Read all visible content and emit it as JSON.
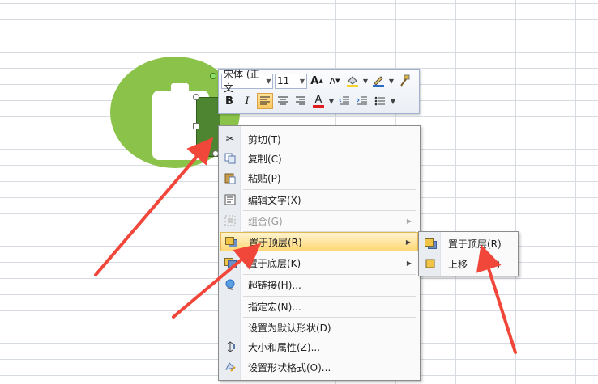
{
  "toolbar": {
    "font_name": "宋体 (正文",
    "font_size": "11",
    "grow_font_glyph": "A",
    "shrink_font_glyph": "A",
    "bold_glyph": "B",
    "italic_glyph": "I",
    "font_color_glyph": "A",
    "fill_color": "#f5d32b",
    "line_color": "#2b6cc4",
    "font_color": "#e02020",
    "icons": [
      "grow-font-icon",
      "shrink-font-icon",
      "fill-color-icon",
      "line-color-icon",
      "format-painter-icon",
      "bold-icon",
      "italic-icon",
      "align-left-icon",
      "align-center-icon",
      "align-right-icon",
      "font-color-icon",
      "decrease-indent-icon",
      "increase-indent-icon",
      "bullets-icon"
    ]
  },
  "context_menu": {
    "items": [
      {
        "label": "剪切(T)",
        "icon": "scissors-icon"
      },
      {
        "label": "复制(C)",
        "icon": "copy-icon"
      },
      {
        "label": "粘贴(P)",
        "icon": "paste-icon"
      },
      {
        "label": "编辑文字(X)",
        "icon": "edit-text-icon"
      },
      {
        "label": "组合(G)",
        "icon": "group-icon",
        "disabled": true
      },
      {
        "label": "置于顶层(R)",
        "icon": "bring-to-front-icon",
        "highlighted": true
      },
      {
        "label": "置于底层(K)",
        "icon": "send-to-back-icon"
      },
      {
        "label": "超链接(H)...",
        "icon": "hyperlink-icon"
      },
      {
        "label": "指定宏(N)...",
        "icon": ""
      },
      {
        "label": "设置为默认形状(D)",
        "icon": ""
      },
      {
        "label": "大小和属性(Z)...",
        "icon": "size-icon"
      },
      {
        "label": "设置形状格式(O)...",
        "icon": "format-shape-icon"
      }
    ]
  },
  "submenu": {
    "items": [
      {
        "label": "置于顶层(R)",
        "icon": "bring-to-front-icon"
      },
      {
        "label": "上移一层(F)",
        "icon": "bring-forward-icon"
      }
    ]
  },
  "colors": {
    "ellipse": "#8bc34a",
    "selected_shape": "#4d8530",
    "highlight": "#ffd776",
    "annotation_arrow": "#f0473a"
  }
}
